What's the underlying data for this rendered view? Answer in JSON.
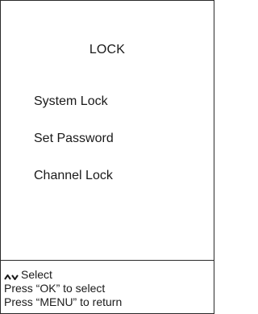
{
  "menu": {
    "title": "LOCK",
    "items": [
      {
        "label": "System Lock"
      },
      {
        "label": "Set Password"
      },
      {
        "label": "Channel Lock"
      }
    ]
  },
  "footer": {
    "nav_icon": "up-down-arrows-icon",
    "nav_label": "Select",
    "ok_hint": "Press “OK” to select",
    "menu_hint": "Press “MENU” to return"
  }
}
